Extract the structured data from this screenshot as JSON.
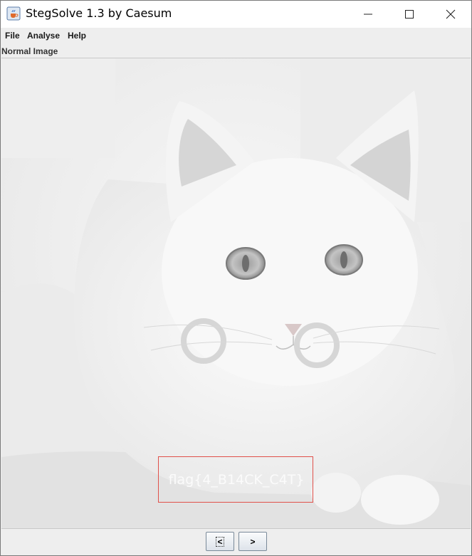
{
  "window": {
    "title": "StegSolve 1.3 by Caesum",
    "app_icon": "java-cup-icon"
  },
  "titlebar_buttons": {
    "minimize_icon": "minimize-icon",
    "maximize_icon": "maximize-icon",
    "close_icon": "close-icon"
  },
  "menu": {
    "items": [
      {
        "label": "File"
      },
      {
        "label": "Analyse"
      },
      {
        "label": "Help"
      }
    ]
  },
  "viewer": {
    "mode_label": "Normal Image",
    "hidden_text": "flag{4_B14CK_C4T}",
    "highlight_color": "#e0504a"
  },
  "navigation": {
    "prev_label": "<",
    "next_label": ">"
  }
}
